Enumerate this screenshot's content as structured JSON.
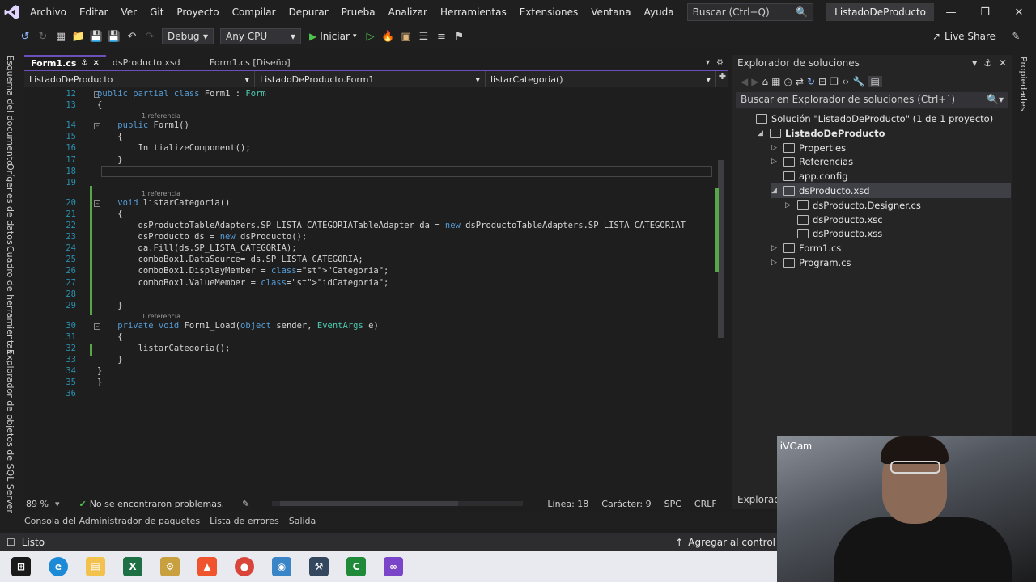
{
  "menu": {
    "items": [
      "Archivo",
      "Editar",
      "Ver",
      "Git",
      "Proyecto",
      "Compilar",
      "Depurar",
      "Prueba",
      "Analizar",
      "Herramientas",
      "Extensiones",
      "Ventana",
      "Ayuda"
    ],
    "search_placeholder": "Buscar (Ctrl+Q)",
    "solution_name": "ListadoDeProducto"
  },
  "toolbar": {
    "config": "Debug",
    "platform": "Any CPU",
    "start_label": "Iniciar",
    "live_share": "Live Share"
  },
  "left_panel": {
    "tabs": [
      "Esquema del documento",
      "Orígenes de datos",
      "Cuadro de herramientas",
      "Explorador de objetos de SQL Server"
    ]
  },
  "right_panel": {
    "tabs": [
      "Propiedades"
    ]
  },
  "editor": {
    "tabs": [
      {
        "label": "Form1.cs",
        "active": true
      },
      {
        "label": "dsProducto.xsd",
        "active": false
      },
      {
        "label": "Form1.cs [Diseño]",
        "active": false
      }
    ],
    "nav": {
      "project": "ListadoDeProducto",
      "class": "ListadoDeProducto.Form1",
      "member": "listarCategoria()"
    },
    "reference_label": "1 referencia",
    "line_numbers": [
      "12",
      "13",
      "14",
      "15",
      "16",
      "17",
      "18",
      "19",
      "20",
      "21",
      "22",
      "23",
      "24",
      "25",
      "26",
      "27",
      "28",
      "29",
      "30",
      "31",
      "32",
      "33",
      "34",
      "35",
      "36"
    ],
    "code_lines": [
      "public partial class Form1 : Form",
      "{",
      "    public Form1()",
      "    {",
      "        InitializeComponent();",
      "    }",
      "",
      "",
      "    void listarCategoria()",
      "    {",
      "        dsProductoTableAdapters.SP_LISTA_CATEGORIATableAdapter da = new dsProductoTableAdapters.SP_LISTA_CATEGORIAT",
      "        dsProducto ds = new dsProducto();",
      "        da.Fill(ds.SP_LISTA_CATEGORIA);",
      "        comboBox1.DataSource= ds.SP_LISTA_CATEGORIA;",
      "        comboBox1.DisplayMember = \"Categoria\";",
      "        comboBox1.ValueMember = \"idCategoria\";",
      "",
      "    }",
      "    private void Form1_Load(object sender, EventArgs e)",
      "    {",
      "        listarCategoria();",
      "    }",
      "}",
      "}",
      ""
    ],
    "zoom": "89 %",
    "issues": "No se encontraron problemas.",
    "line": "Línea: 18",
    "column": "Carácter: 9",
    "spacing": "SPC",
    "eol": "CRLF"
  },
  "solution_explorer": {
    "title": "Explorador de soluciones",
    "search_placeholder": "Buscar en Explorador de soluciones (Ctrl+`)",
    "nodes": [
      {
        "label": "Solución \"ListadoDeProducto\" (1 de 1 proyecto)",
        "depth": 0,
        "arrow": "",
        "bold": false
      },
      {
        "label": "ListadoDeProducto",
        "depth": 1,
        "arrow": "◢",
        "bold": true
      },
      {
        "label": "Properties",
        "depth": 2,
        "arrow": "▷",
        "bold": false
      },
      {
        "label": "Referencias",
        "depth": 2,
        "arrow": "▷",
        "bold": false
      },
      {
        "label": "app.config",
        "depth": 2,
        "arrow": "",
        "bold": false
      },
      {
        "label": "dsProducto.xsd",
        "depth": 2,
        "arrow": "◢",
        "bold": false,
        "selected": true
      },
      {
        "label": "dsProducto.Designer.cs",
        "depth": 3,
        "arrow": "▷",
        "bold": false
      },
      {
        "label": "dsProducto.xsc",
        "depth": 3,
        "arrow": "",
        "bold": false
      },
      {
        "label": "dsProducto.xss",
        "depth": 3,
        "arrow": "",
        "bold": false
      },
      {
        "label": "Form1.cs",
        "depth": 2,
        "arrow": "▷",
        "bold": false
      },
      {
        "label": "Program.cs",
        "depth": 2,
        "arrow": "▷",
        "bold": false
      }
    ],
    "footer_tab": "Explorado"
  },
  "bottom_tabs": [
    "Consola del Administrador de paquetes",
    "Lista de errores",
    "Salida"
  ],
  "status": {
    "ready": "Listo",
    "add_source": "Agregar al control"
  },
  "webcam": {
    "label": "iVCam"
  },
  "taskbar": {
    "apps": [
      "windows-start",
      "edge",
      "file-explorer",
      "excel",
      "app-tool",
      "brave",
      "chrome",
      "outlook-app",
      "sql-server-management",
      "camtasia",
      "visual-studio"
    ]
  }
}
